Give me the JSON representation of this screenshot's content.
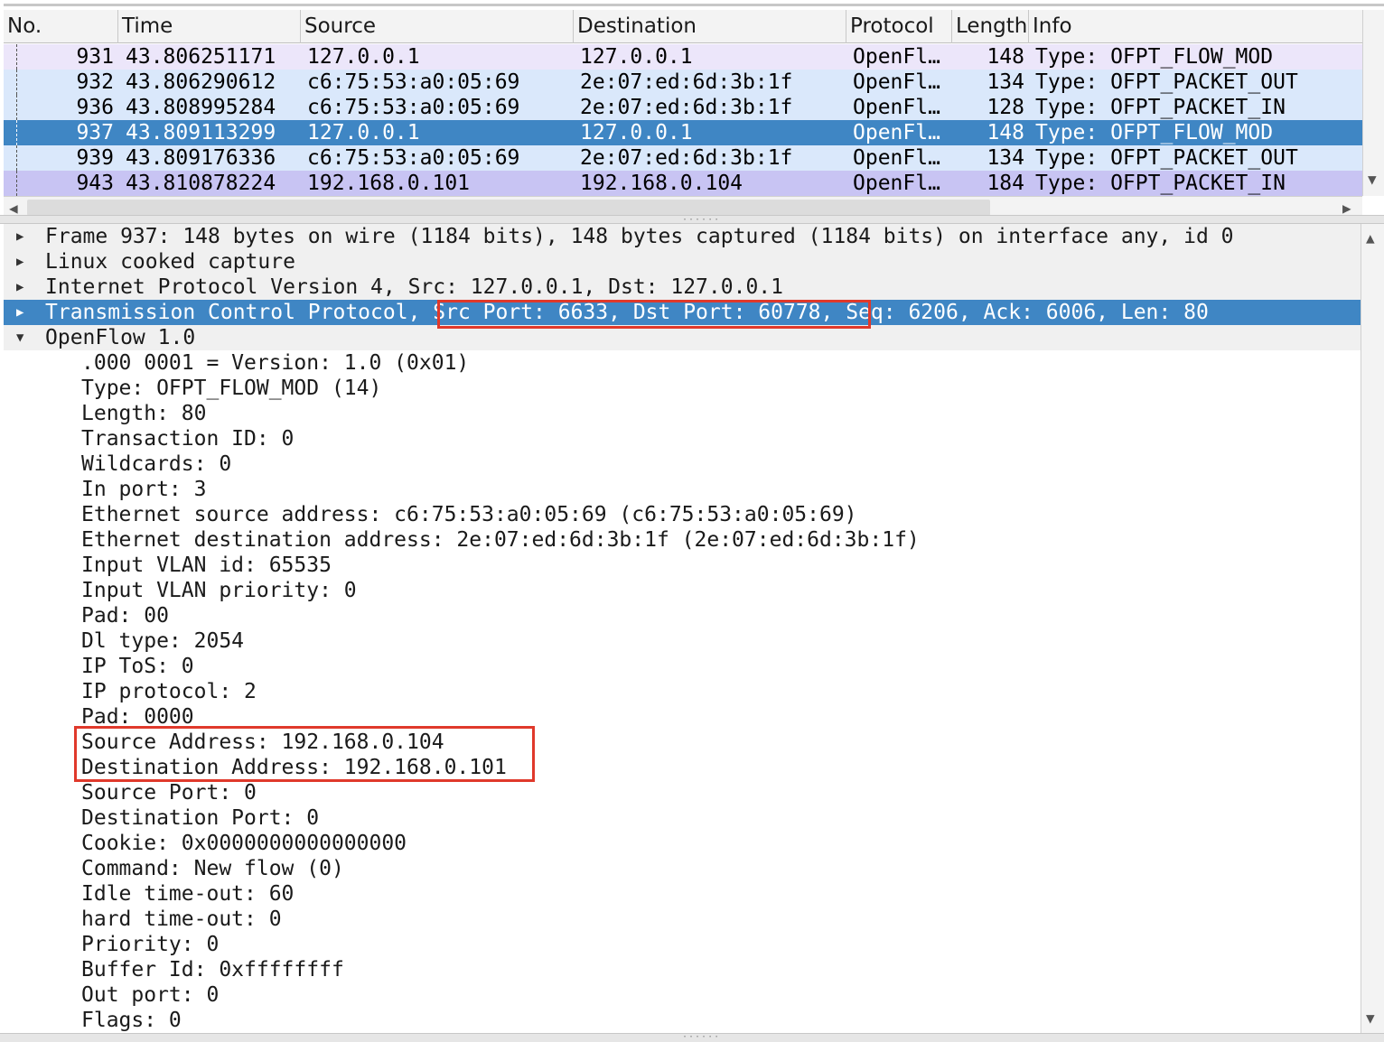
{
  "packet_list": {
    "columns": [
      "No.",
      "Time",
      "Source",
      "Destination",
      "Protocol",
      "Length",
      "Info"
    ],
    "rows": [
      {
        "no": "931",
        "time": "43.806251171",
        "source": "127.0.0.1",
        "destination": "127.0.0.1",
        "protocol": "OpenFl…",
        "length": "148",
        "info": "Type: OFPT_FLOW_MOD",
        "bg": "#ece6fa"
      },
      {
        "no": "932",
        "time": "43.806290612",
        "source": "c6:75:53:a0:05:69",
        "destination": "2e:07:ed:6d:3b:1f",
        "protocol": "OpenFl…",
        "length": "134",
        "info": "Type: OFPT_PACKET_OUT",
        "bg": "#dae8fb"
      },
      {
        "no": "936",
        "time": "43.808995284",
        "source": "c6:75:53:a0:05:69",
        "destination": "2e:07:ed:6d:3b:1f",
        "protocol": "OpenFl…",
        "length": "128",
        "info": "Type: OFPT_PACKET_IN",
        "bg": "#dae8fb"
      },
      {
        "no": "937",
        "time": "43.809113299",
        "source": "127.0.0.1",
        "destination": "127.0.0.1",
        "protocol": "OpenFl…",
        "length": "148",
        "info": "Type: OFPT_FLOW_MOD",
        "bg": "#3f86c4",
        "fg": "#ffffff"
      },
      {
        "no": "939",
        "time": "43.809176336",
        "source": "c6:75:53:a0:05:69",
        "destination": "2e:07:ed:6d:3b:1f",
        "protocol": "OpenFl…",
        "length": "134",
        "info": "Type: OFPT_PACKET_OUT",
        "bg": "#dae8fb"
      },
      {
        "no": "943",
        "time": "43.810878224",
        "source": "192.168.0.101",
        "destination": "192.168.0.104",
        "protocol": "OpenFl…",
        "length": "184",
        "info": "Type: OFPT_PACKET_IN",
        "bg": "#c8c4f3"
      }
    ]
  },
  "details": {
    "rows": [
      {
        "text": "Frame 937: 148 bytes on wire (1184 bits), 148 bytes captured (1184 bits) on interface any, id 0",
        "expander": "collapsed"
      },
      {
        "text": "Linux cooked capture",
        "expander": "collapsed"
      },
      {
        "text": "Internet Protocol Version 4, Src: 127.0.0.1, Dst: 127.0.0.1",
        "expander": "collapsed"
      },
      {
        "text": "Transmission Control Protocol, Src Port: 6633, Dst Port: 60778, Seq: 6206, Ack: 6006, Len: 80",
        "expander": "collapsed",
        "selected": true
      },
      {
        "text": "OpenFlow 1.0",
        "expander": "expanded"
      },
      {
        "text": ".000 0001 = Version: 1.0 (0x01)",
        "child": true
      },
      {
        "text": "Type: OFPT_FLOW_MOD (14)",
        "child": true
      },
      {
        "text": "Length: 80",
        "child": true
      },
      {
        "text": "Transaction ID: 0",
        "child": true
      },
      {
        "text": "Wildcards: 0",
        "child": true
      },
      {
        "text": "In port: 3",
        "child": true
      },
      {
        "text": "Ethernet source address: c6:75:53:a0:05:69 (c6:75:53:a0:05:69)",
        "child": true
      },
      {
        "text": "Ethernet destination address: 2e:07:ed:6d:3b:1f (2e:07:ed:6d:3b:1f)",
        "child": true
      },
      {
        "text": "Input VLAN id: 65535",
        "child": true
      },
      {
        "text": "Input VLAN priority: 0",
        "child": true
      },
      {
        "text": "Pad: 00",
        "child": true
      },
      {
        "text": "Dl type: 2054",
        "child": true
      },
      {
        "text": "IP ToS: 0",
        "child": true
      },
      {
        "text": "IP protocol: 2",
        "child": true
      },
      {
        "text": "Pad: 0000",
        "child": true
      },
      {
        "text": "Source Address: 192.168.0.104",
        "child": true
      },
      {
        "text": "Destination Address: 192.168.0.101",
        "child": true
      },
      {
        "text": "Source Port: 0",
        "child": true
      },
      {
        "text": "Destination Port: 0",
        "child": true
      },
      {
        "text": "Cookie: 0x0000000000000000",
        "child": true
      },
      {
        "text": "Command: New flow (0)",
        "child": true
      },
      {
        "text": "Idle time-out: 60",
        "child": true
      },
      {
        "text": "hard time-out: 0",
        "child": true
      },
      {
        "text": "Priority: 0",
        "child": true
      },
      {
        "text": "Buffer Id: 0xffffffff",
        "child": true
      },
      {
        "text": "Out port: 0",
        "child": true
      },
      {
        "text": "Flags: 0",
        "child": true
      }
    ]
  },
  "colors": {
    "selection": "#3f86c4",
    "annotation_box": "#e0392b"
  },
  "icons": {
    "collapsed": "triangle-right-icon",
    "expanded": "triangle-down-icon"
  }
}
